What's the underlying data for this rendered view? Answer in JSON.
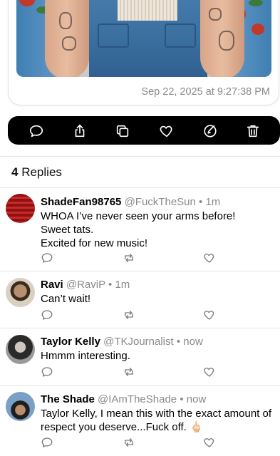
{
  "post": {
    "timestamp": "Sep 22, 2025 at 9:27:38 PM"
  },
  "actions": [
    {
      "icon": "reply-icon"
    },
    {
      "icon": "share-icon"
    },
    {
      "icon": "copy-icon"
    },
    {
      "icon": "like-icon"
    },
    {
      "icon": "quote-icon"
    },
    {
      "icon": "delete-icon"
    }
  ],
  "replies_header": {
    "count": "4",
    "label": "Replies"
  },
  "replies": [
    {
      "name": "ShadeFan98765",
      "handle": "@FuckTheSun",
      "separator": "•",
      "time": "1m",
      "lines": [
        "WHOA I’ve never seen your arms before!",
        "Sweet tats.",
        "Excited for new music!"
      ]
    },
    {
      "name": "Ravi",
      "handle": "@RaviP",
      "separator": "•",
      "time": "1m",
      "lines": [
        "Can’t wait!"
      ]
    },
    {
      "name": "Taylor Kelly",
      "handle": "@TKJournalist",
      "separator": "•",
      "time": "now",
      "lines": [
        "Hmmm interesting."
      ]
    },
    {
      "name": "The Shade",
      "handle": "@IAmTheShade",
      "separator": "•",
      "time": "now",
      "lines": [
        "Taylor Kelly, I mean this with the exact amount of",
        "respect you deserve...Fuck off. 🖕🏻"
      ]
    }
  ],
  "colors": {
    "action_bar": "#000000",
    "secondary_text": "#8a8a8e",
    "icon_gray": "#7a7a7e"
  }
}
